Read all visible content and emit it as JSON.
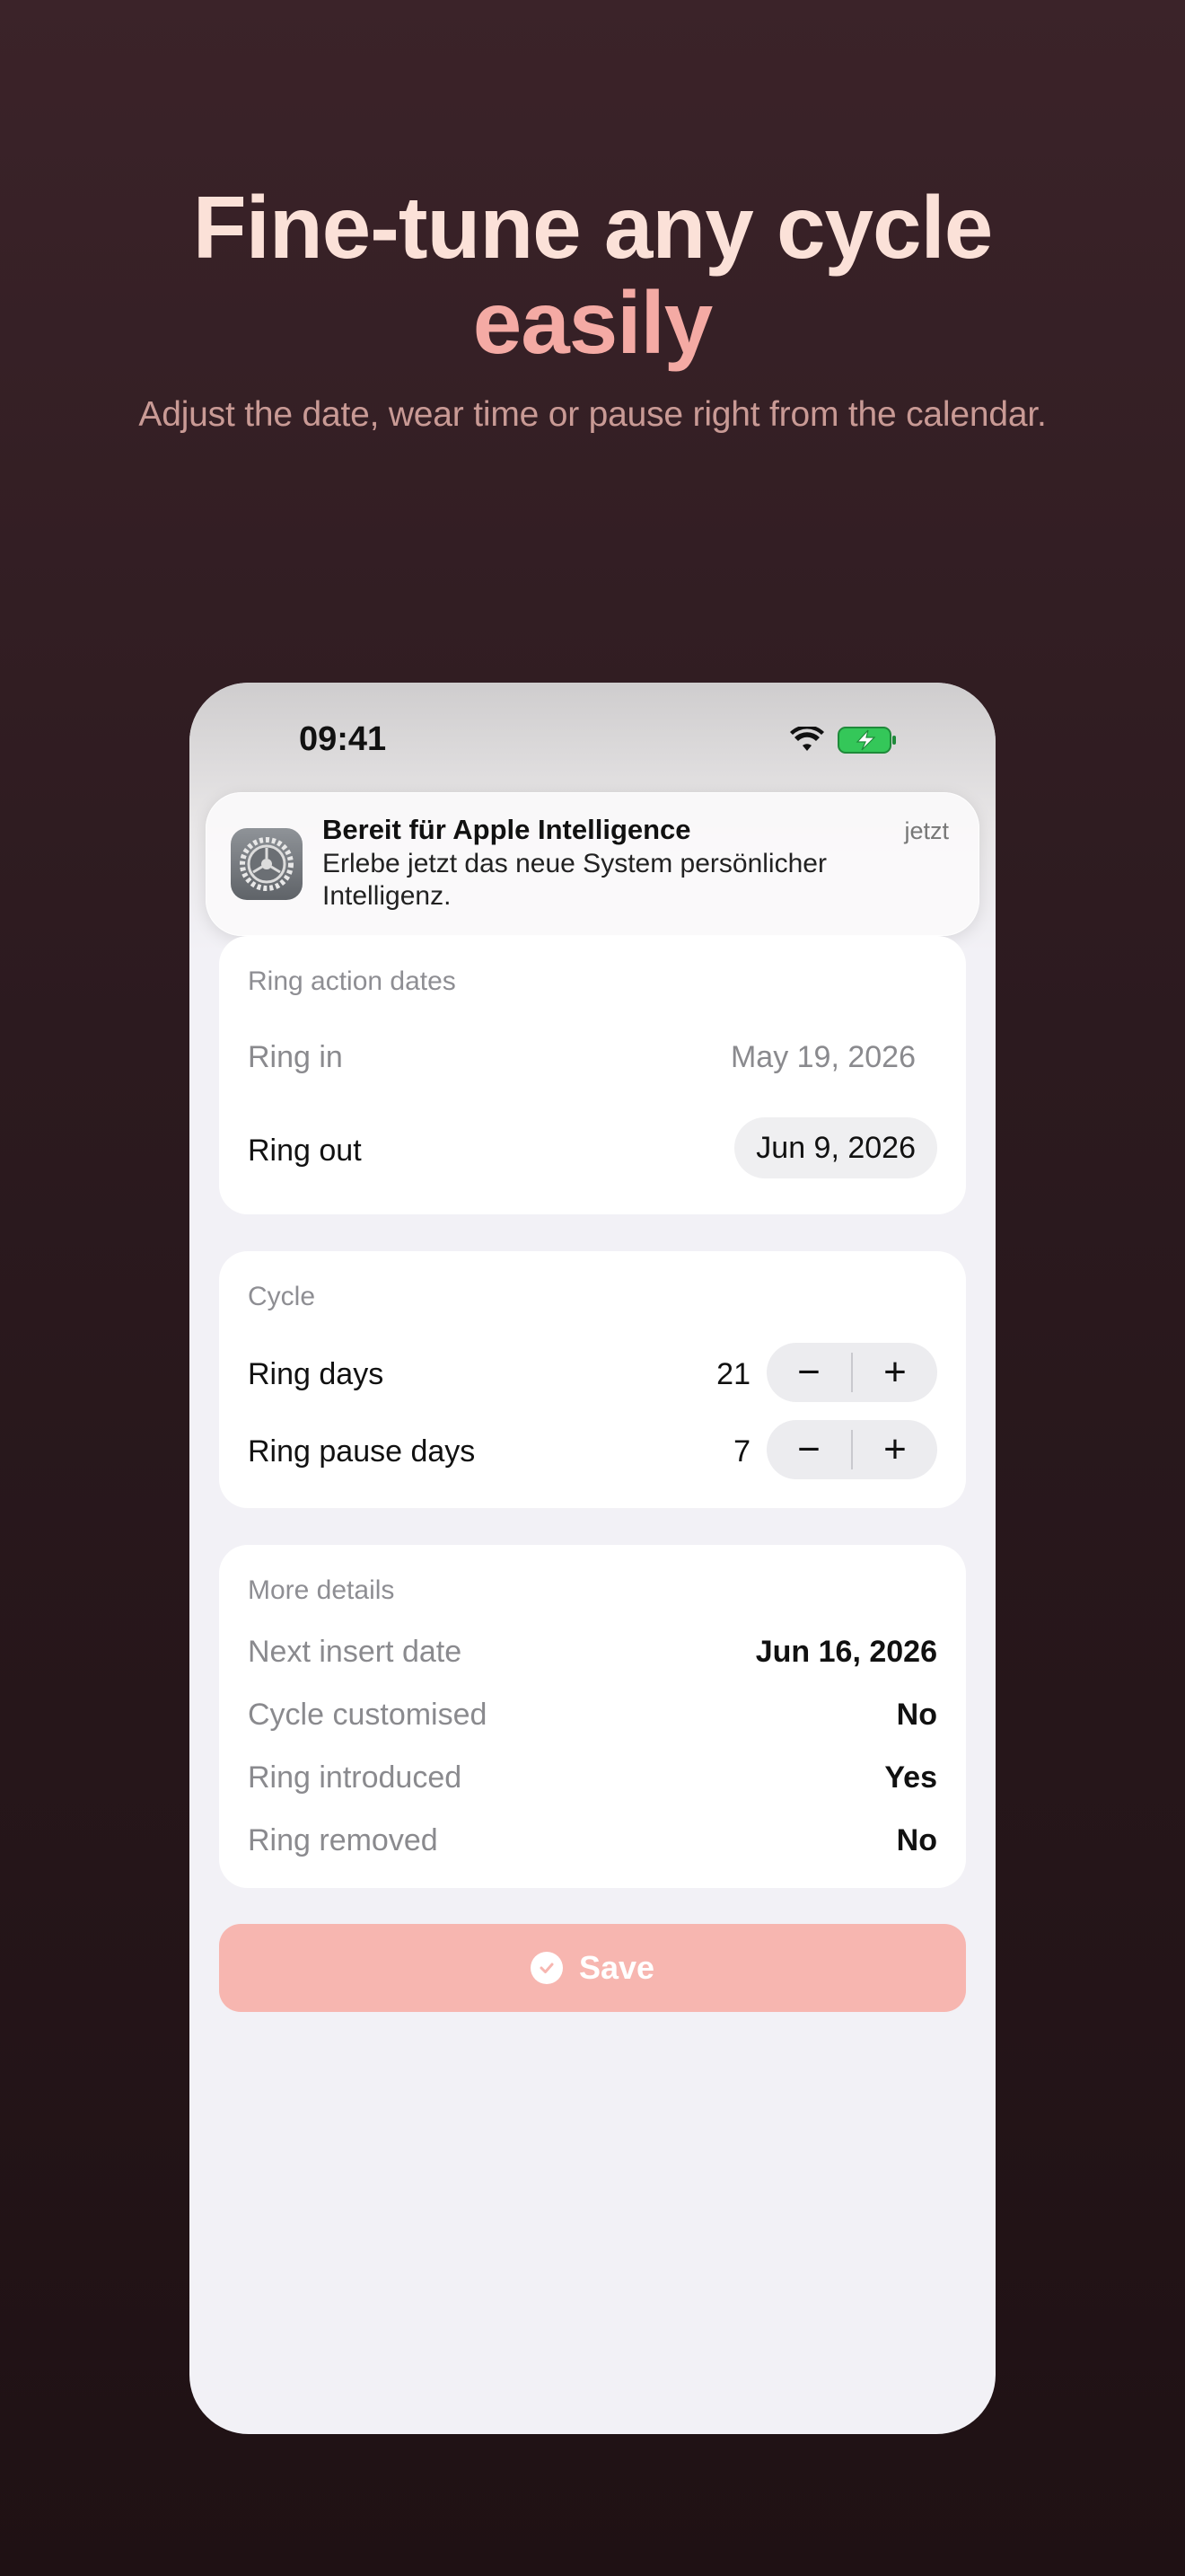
{
  "hero": {
    "title": "Fine-tune any cycle",
    "title_accent": "easily",
    "subtitle": "Adjust the date, wear time or pause right from the calendar."
  },
  "status_bar": {
    "time": "09:41"
  },
  "notification": {
    "title": "Bereit für Apple Intelligence",
    "body": "Erlebe jetzt das neue System persönlicher Intelligenz.",
    "time": "jetzt",
    "app_icon": "settings-gear-icon"
  },
  "ring_action_dates": {
    "header": "Ring action dates",
    "ring_in_label": "Ring in",
    "ring_in_value": "May 19, 2026",
    "ring_out_label": "Ring out",
    "ring_out_value": "Jun 9, 2026"
  },
  "cycle": {
    "header": "Cycle",
    "ring_days_label": "Ring days",
    "ring_days_value": "21",
    "ring_pause_days_label": "Ring pause days",
    "ring_pause_days_value": "7",
    "minus_symbol": "−",
    "plus_symbol": "+"
  },
  "more_details": {
    "header": "More details",
    "rows": [
      {
        "label": "Next insert date",
        "value": "Jun 16, 2026"
      },
      {
        "label": "Cycle customised",
        "value": "No"
      },
      {
        "label": "Ring introduced",
        "value": "Yes"
      },
      {
        "label": "Ring removed",
        "value": "No"
      }
    ]
  },
  "save_button": {
    "label": "Save"
  },
  "colors": {
    "accent": "#f7b6b0",
    "hero_text": "#fbe1d8",
    "hero_accent": "#f4aaa4",
    "battery_green": "#34c759"
  }
}
